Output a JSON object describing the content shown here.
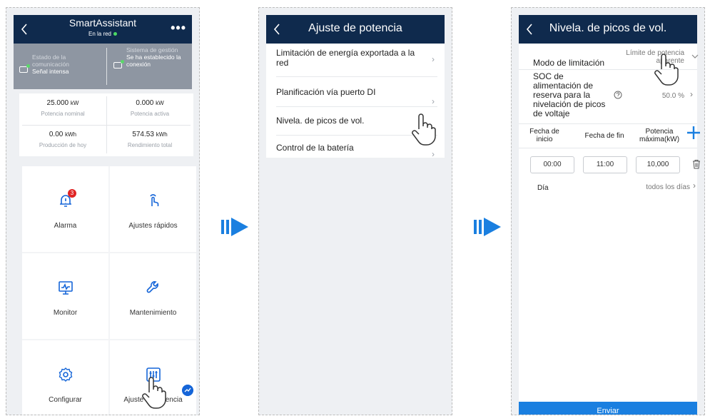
{
  "screen1": {
    "title": "SmartAssistant",
    "subtitle": "En la red",
    "more": "•••",
    "comm_label": "Estado de la comunicación",
    "comm_value": "Señal intensa",
    "mgmt_label": "Sistema de gestión",
    "mgmt_value": "Se ha establecido la conexión",
    "kpis": [
      {
        "value": "25.000",
        "unit": "kW",
        "label": "Potencia nominal"
      },
      {
        "value": "0.000",
        "unit": "kW",
        "label": "Potencia activa"
      },
      {
        "value": "0.00",
        "unit": "kWh",
        "label": "Producción de hoy"
      },
      {
        "value": "574.53",
        "unit": "kWh",
        "label": "Rendimiento total"
      }
    ],
    "tiles": [
      {
        "label": "Alarma",
        "icon": "bell-icon",
        "badge": "3"
      },
      {
        "label": "Ajustes rápidos",
        "icon": "touch-icon"
      },
      {
        "label": "Monitor",
        "icon": "monitor-icon"
      },
      {
        "label": "Mantenimiento",
        "icon": "wrench-icon"
      },
      {
        "label": "Configurar",
        "icon": "gear-icon"
      },
      {
        "label": "Ajuste de potencia",
        "icon": "sliders-icon"
      }
    ]
  },
  "screen2": {
    "title": "Ajuste de potencia",
    "items": [
      {
        "label": "Limitación de energía exportada a la red"
      },
      {
        "label": "Planificación vía puerto DI"
      },
      {
        "label": "Nivela. de picos de vol."
      },
      {
        "label": "Control de la batería"
      }
    ]
  },
  "screen3": {
    "title": "Nivela. de picos de vol.",
    "mode_label": "Modo de limitación",
    "mode_value": "Límite de potencia aparente",
    "soc_label": "SOC de alimentación de reserva para la nivelación de picos de voltaje",
    "soc_value": "50.0 %",
    "table_headers": [
      "Fecha de inicio",
      "Fecha de fin",
      "Potencia máxima(kW)"
    ],
    "row": {
      "start": "00:00",
      "end": "11:00",
      "power": "10,000"
    },
    "day_label": "Día",
    "day_value": "todos los días",
    "submit": "Enviar"
  },
  "colors": {
    "header": "#0f2a4d",
    "accent": "#1a7fe0",
    "arrow": "#1a7fe0",
    "badge": "#e02424"
  }
}
